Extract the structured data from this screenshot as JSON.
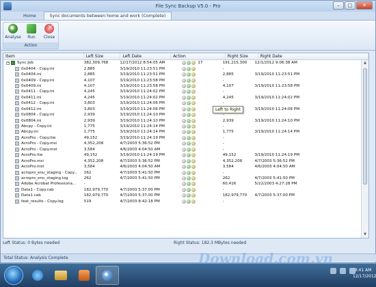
{
  "window": {
    "title": "File Sync Backup V5.0 - Pro"
  },
  "tabs": [
    {
      "label": "Home"
    },
    {
      "label": "Sync documents between home and work (Complete)"
    }
  ],
  "ribbon": {
    "buttons": [
      {
        "label": "Analyse"
      },
      {
        "label": "Run"
      },
      {
        "label": "Close"
      }
    ],
    "group_label": "Action"
  },
  "grid": {
    "columns": [
      "Item",
      "Left Size",
      "Left Date",
      "Action",
      "Right Size",
      "Right Date"
    ],
    "rows": [
      {
        "name": "Sync Job",
        "left_size": "382,309,768",
        "left_date": "12/17/2012 8:54:05 AM",
        "action_count": "17",
        "right_size": "191,215,300",
        "right_date": "12/1/2012 9:06:38 AM"
      },
      {
        "name": "0x0404 - Copy.ini",
        "left_size": "2,885",
        "left_date": "3/19/2010 11:23:51 PM",
        "right_size": "-",
        "right_date": ""
      },
      {
        "name": "0x0404.ini",
        "left_size": "2,885",
        "left_date": "3/19/2010 11:23:51 PM",
        "right_size": "2,885",
        "right_date": "3/19/2010 11:23:51 PM"
      },
      {
        "name": "0x0409 - Copy.ini",
        "left_size": "4,107",
        "left_date": "3/19/2010 11:23:58 PM",
        "right_size": "-",
        "right_date": ""
      },
      {
        "name": "0x0409.ini",
        "left_size": "4,107",
        "left_date": "3/19/2010 11:23:58 PM",
        "right_size": "4,107",
        "right_date": "3/19/2010 11:23:58 PM"
      },
      {
        "name": "0x0411 - Copy.ini",
        "left_size": "4,245",
        "left_date": "3/19/2010 11:24:02 PM",
        "right_size": "-",
        "right_date": ""
      },
      {
        "name": "0x0411.ini",
        "left_size": "4,245",
        "left_date": "3/19/2010 11:24:02 PM",
        "right_size": "4,245",
        "right_date": "3/19/2010 11:24:02 PM"
      },
      {
        "name": "0x0412 - Copy.ini",
        "left_size": "3,803",
        "left_date": "3/19/2010 11:24:06 PM",
        "right_size": "-",
        "right_date": ""
      },
      {
        "name": "0x0412.ini",
        "left_size": "3,803",
        "left_date": "3/19/2010 11:24:06 PM",
        "right_size": "3,803",
        "right_date": "3/19/2010 11:24:06 PM"
      },
      {
        "name": "0x0804 - Copy.ini",
        "left_size": "2,939",
        "left_date": "3/19/2010 11:24:10 PM",
        "right_size": "-",
        "right_date": ""
      },
      {
        "name": "0x0804.ini",
        "left_size": "2,939",
        "left_date": "3/19/2010 11:24:10 PM",
        "right_size": "2,939",
        "right_date": "3/19/2010 11:24:10 PM"
      },
      {
        "name": "Abcpy - Copy.ini",
        "left_size": "1,775",
        "left_date": "3/19/2010 11:24:14 PM",
        "right_size": "-",
        "right_date": ""
      },
      {
        "name": "Abcpy.ini",
        "left_size": "1,775",
        "left_date": "3/19/2010 11:24:14 PM",
        "right_size": "1,775",
        "right_date": "3/19/2010 11:24:14 PM"
      },
      {
        "name": "AcroPro - Copy.itw",
        "left_size": "49,152",
        "left_date": "3/19/2010 11:24:19 PM",
        "right_size": "-",
        "right_date": ""
      },
      {
        "name": "AcroPro - Copy.msi",
        "left_size": "4,352,208",
        "left_date": "4/7/2003 5:36:52 PM",
        "right_size": "-",
        "right_date": ""
      },
      {
        "name": "AcroPro - Copy.mst",
        "left_size": "3,584",
        "left_date": "4/6/2003 4:04:50 AM",
        "right_size": "-",
        "right_date": ""
      },
      {
        "name": "AcroPro.itw",
        "left_size": "49,152",
        "left_date": "3/19/2010 11:24:19 PM",
        "right_size": "49,152",
        "right_date": "3/19/2010 11:24:19 PM"
      },
      {
        "name": "AcroPro.msi",
        "left_size": "4,352,208",
        "left_date": "4/7/2003 5:36:52 PM",
        "right_size": "4,352,208",
        "right_date": "4/7/2003 5:36:52 PM"
      },
      {
        "name": "AcroPro.mst",
        "left_size": "3,584",
        "left_date": "4/6/2003 4:04:50 AM",
        "right_size": "3,584",
        "right_date": "4/6/2003 4:04:50 AM"
      },
      {
        "name": "acropro_enu_staging - Copy...",
        "left_size": "262",
        "left_date": "4/7/2003 5:41:50 PM",
        "right_size": "-",
        "right_date": ""
      },
      {
        "name": "acropro_enu_staging.log",
        "left_size": "262",
        "left_date": "4/7/2003 5:41:50 PM",
        "right_size": "262",
        "right_date": "4/7/2003 5:41:50 PM"
      },
      {
        "name": "Adobe Acrobat Professiona...",
        "left_size": "-",
        "left_date": "",
        "right_size": "60,416",
        "right_date": "5/22/2003 4:27:28 PM"
      },
      {
        "name": "Data1 - Copy.cab",
        "left_size": "182,979,770",
        "left_date": "4/7/2003 5:37:00 PM",
        "right_size": "-",
        "right_date": ""
      },
      {
        "name": "Data1.cab",
        "left_size": "182,979,770",
        "left_date": "4/7/2003 5:37:00 PM",
        "right_size": "182,979,770",
        "right_date": "4/7/2003 5:37:00 PM"
      },
      {
        "name": "feat_results - Copy.log",
        "left_size": "519",
        "left_date": "4/7/2003 8:42:18 PM",
        "right_size": "-",
        "right_date": ""
      }
    ]
  },
  "tooltip": "Left to Right",
  "status": {
    "left": "Left Status: 0 Bytes needed",
    "right": "Right Status: 182.3 MBytes needed",
    "total": "Total Status: Analysis Complete"
  },
  "watermark": "Download.com.vn",
  "clock": {
    "time": "9:41 AM",
    "date": "12/17/2012"
  }
}
